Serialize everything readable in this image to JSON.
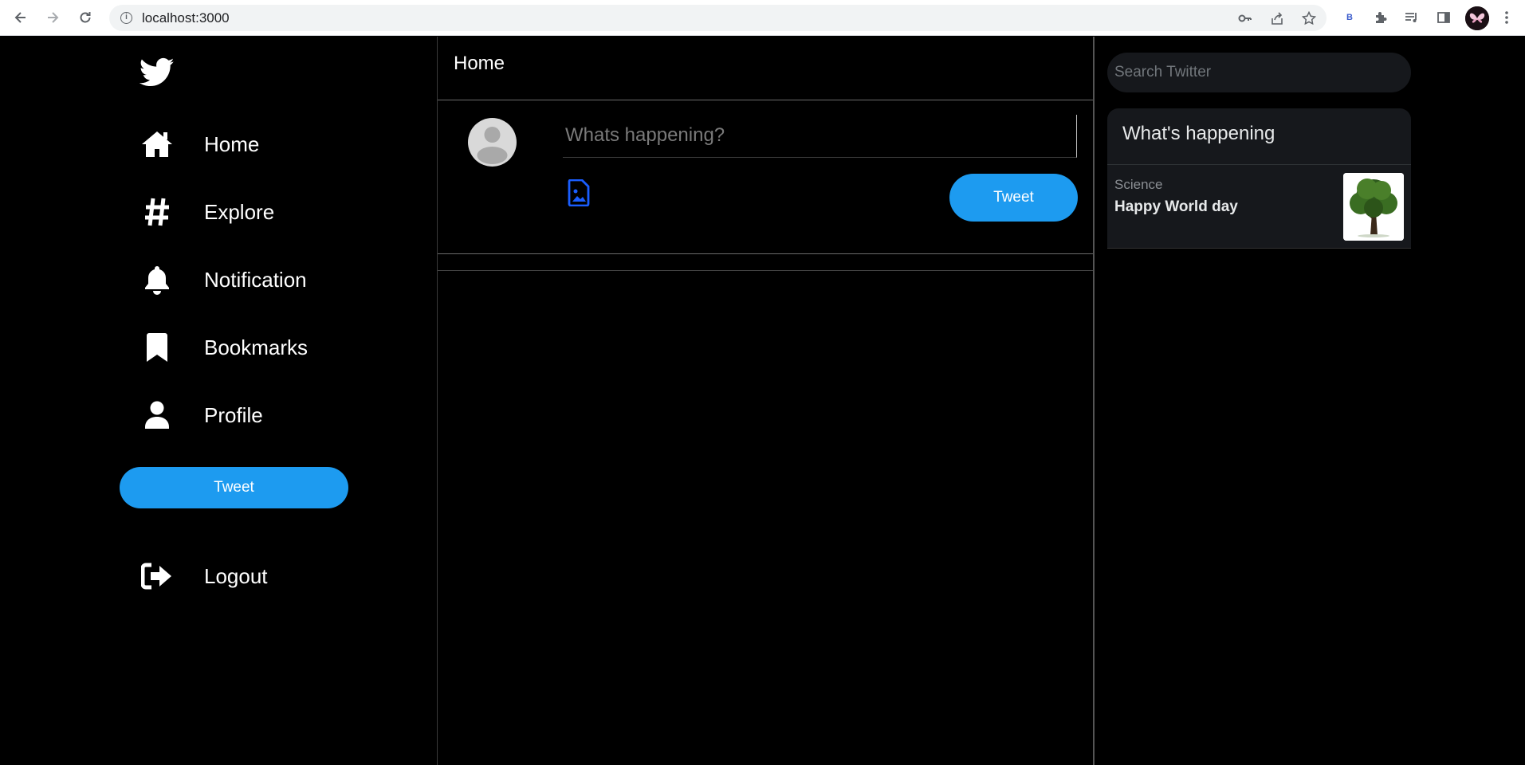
{
  "browser": {
    "url": "localhost:3000",
    "extension_badge": "B"
  },
  "sidebar": {
    "items": [
      {
        "label": "Home",
        "icon": "home-icon"
      },
      {
        "label": "Explore",
        "icon": "hashtag-icon"
      },
      {
        "label": "Notification",
        "icon": "bell-icon"
      },
      {
        "label": "Bookmarks",
        "icon": "bookmark-icon"
      },
      {
        "label": "Profile",
        "icon": "user-icon"
      }
    ],
    "tweet_label": "Tweet",
    "logout_label": "Logout"
  },
  "main": {
    "title": "Home",
    "composer": {
      "placeholder": "Whats happening?",
      "tweet_label": "Tweet"
    }
  },
  "right": {
    "search_placeholder": "Search Twitter",
    "trends_title": "What's happening",
    "trends": [
      {
        "category": "Science",
        "text": "Happy World day"
      }
    ]
  },
  "colors": {
    "accent": "#1d9bf0",
    "background": "#000000",
    "panel": "#16181c",
    "media_icon": "#1a5eff"
  }
}
